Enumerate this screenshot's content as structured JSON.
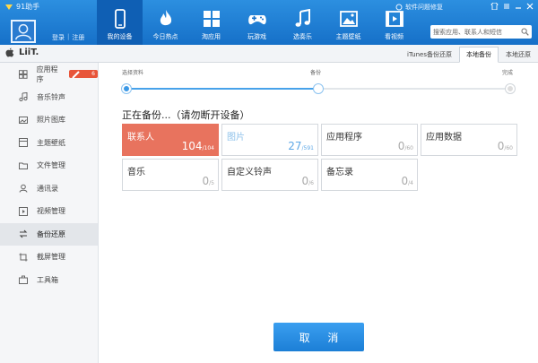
{
  "app": {
    "title": "91助手"
  },
  "header": {
    "login": "登录",
    "register": "注册",
    "separator": "|",
    "feedback": "软件问题修复",
    "search_placeholder": "搜索应用、联系人和短信"
  },
  "nav": [
    {
      "label": "我的设备",
      "icon": "phone-icon"
    },
    {
      "label": "今日热点",
      "icon": "flame-icon"
    },
    {
      "label": "淘应用",
      "icon": "grid-icon"
    },
    {
      "label": "玩游戏",
      "icon": "gamepad-icon"
    },
    {
      "label": "选奏乐",
      "icon": "music-note-icon"
    },
    {
      "label": "主题壁纸",
      "icon": "picture-icon"
    },
    {
      "label": "看视频",
      "icon": "film-icon"
    }
  ],
  "device": {
    "name": "LiiT."
  },
  "tabs": [
    {
      "label": "iTunes备份还原"
    },
    {
      "label": "本地备份"
    },
    {
      "label": "本地还原"
    }
  ],
  "sidebar": {
    "items": [
      {
        "label": "应用程序",
        "badge": "6"
      },
      {
        "label": "音乐铃声"
      },
      {
        "label": "照片图库"
      },
      {
        "label": "主题壁纸"
      },
      {
        "label": "文件管理"
      },
      {
        "label": "通讯录"
      },
      {
        "label": "视频管理"
      },
      {
        "label": "备份还原"
      },
      {
        "label": "截屏管理"
      },
      {
        "label": "工具箱"
      }
    ]
  },
  "steps": [
    {
      "label": "选择资料"
    },
    {
      "label": "备份"
    },
    {
      "label": "完成"
    }
  ],
  "status": {
    "title": "正在备份...（请勿断开设备）"
  },
  "items": [
    {
      "name": "联系人",
      "count": "104",
      "total": "/104"
    },
    {
      "name": "图片",
      "count": "27",
      "total": "/591"
    },
    {
      "name": "应用程序",
      "count": "0",
      "total": "/60"
    },
    {
      "name": "应用数据",
      "count": "0",
      "total": "/60"
    },
    {
      "name": "音乐",
      "count": "0",
      "total": "/5"
    },
    {
      "name": "自定义铃声",
      "count": "0",
      "total": "/6"
    },
    {
      "name": "备忘录",
      "count": "0",
      "total": "/4"
    }
  ],
  "actions": {
    "cancel": "取 消"
  },
  "colors": {
    "header": "#1670c8",
    "done_card": "#e8735e",
    "accent": "#3b98e6"
  }
}
